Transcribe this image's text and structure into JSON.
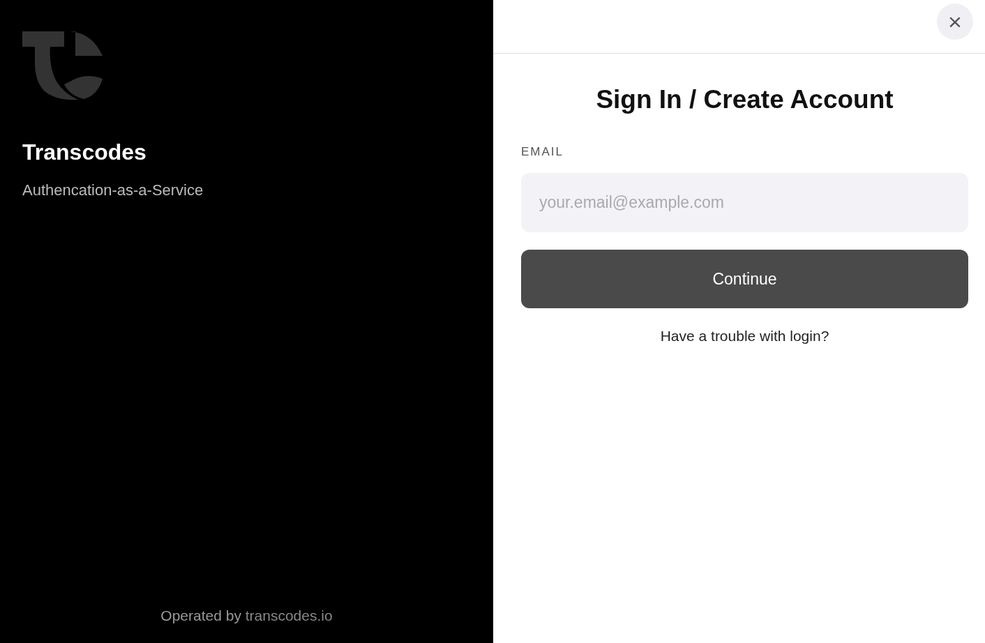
{
  "brand": {
    "name": "Transcodes",
    "tagline": "Authencation-as-a-Service"
  },
  "footer": {
    "text": "Operated by",
    "link": "transcodes.io"
  },
  "close_button": {
    "label": "×"
  },
  "form": {
    "title": "Sign In / Create Account",
    "email_label": "EMAIL",
    "email_placeholder": "your.email@example.com",
    "submit": "Continue",
    "help_link": "Have a trouble with login?"
  }
}
